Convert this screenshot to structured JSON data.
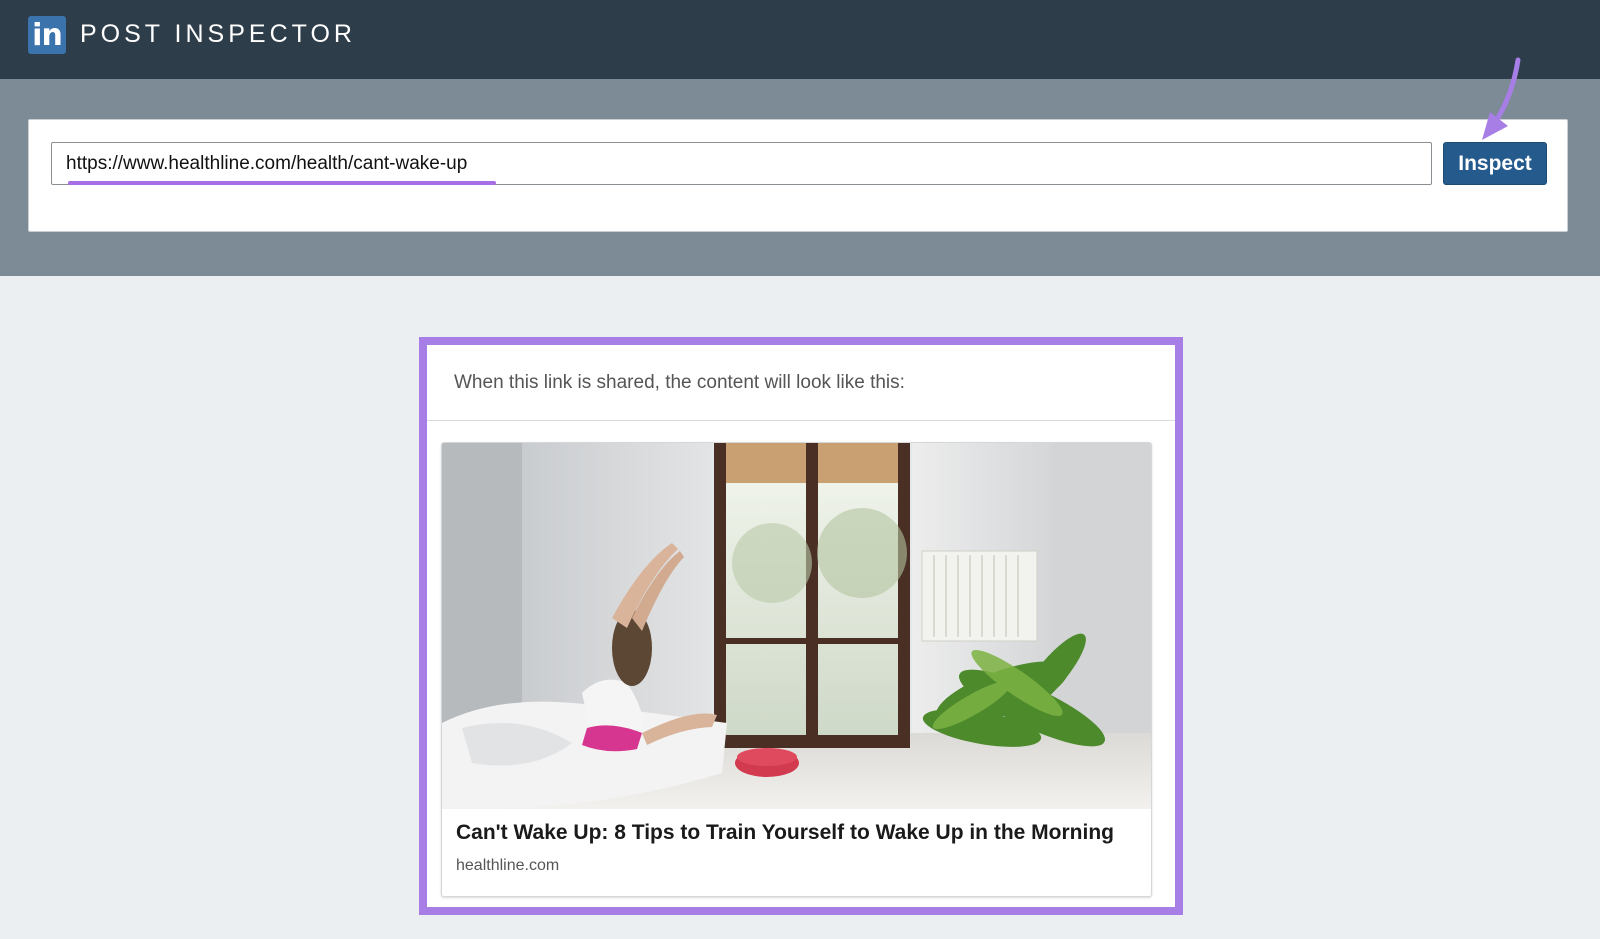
{
  "header": {
    "logo_text": "in",
    "title": "POST INSPECTOR"
  },
  "search": {
    "url_value": "https://www.healthline.com/health/cant-wake-up",
    "inspect_label": "Inspect"
  },
  "preview": {
    "caption": "When this link is shared, the content will look like this:",
    "card": {
      "title": "Can't Wake Up: 8 Tips to Train Yourself to Wake Up in the Morning",
      "domain": "healthline.com"
    }
  },
  "colors": {
    "header_bg": "#2e3d4a",
    "search_band_bg": "#7d8b97",
    "linkedin_blue": "#3b73ad",
    "inspect_button": "#255b8c",
    "highlight_purple": "#a77de6"
  },
  "icons": {
    "logo": "linkedin-logo-icon",
    "annotation": "pointer-arrow-icon"
  }
}
